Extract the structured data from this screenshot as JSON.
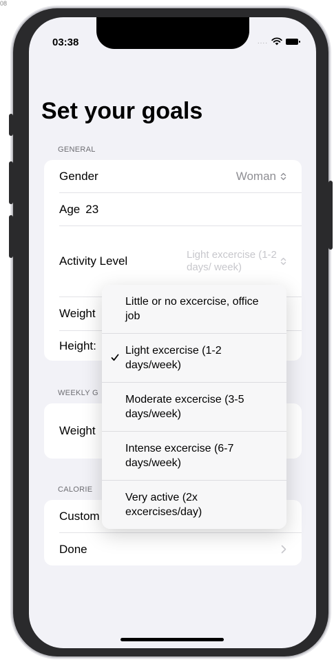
{
  "corner_text": "08",
  "status": {
    "time": "03:38",
    "dots": "....",
    "wifi_icon": "wifi-icon",
    "battery_icon": "battery-icon"
  },
  "page": {
    "title": "Set your goals"
  },
  "general": {
    "header": "GENERAL",
    "gender": {
      "label": "Gender",
      "value": "Woman"
    },
    "age": {
      "label": "Age",
      "value": "23"
    },
    "activity": {
      "label": "Activity Level",
      "value": "Light excercise (1-2 days/ week)"
    },
    "weight": {
      "label": "Weight"
    },
    "height": {
      "label": "Height:"
    }
  },
  "weekly": {
    "header": "WEEKLY G",
    "weight": {
      "label": "Weight"
    }
  },
  "calorie": {
    "header": "CALORIE",
    "custom": {
      "label": "Custom"
    },
    "done": {
      "label": "Done"
    }
  },
  "activity_menu": {
    "selected_index": 1,
    "options": [
      "Little or no excercise, office job",
      "Light excercise (1-2 days/week)",
      "Moderate excercise (3-5 days/week)",
      "Intense excercise (6-7 days/week)",
      "Very active (2x excercises/day)"
    ]
  },
  "colors": {
    "screen_bg": "#f2f2f7",
    "card_bg": "#ffffff",
    "secondary_text": "#8e8e93"
  }
}
